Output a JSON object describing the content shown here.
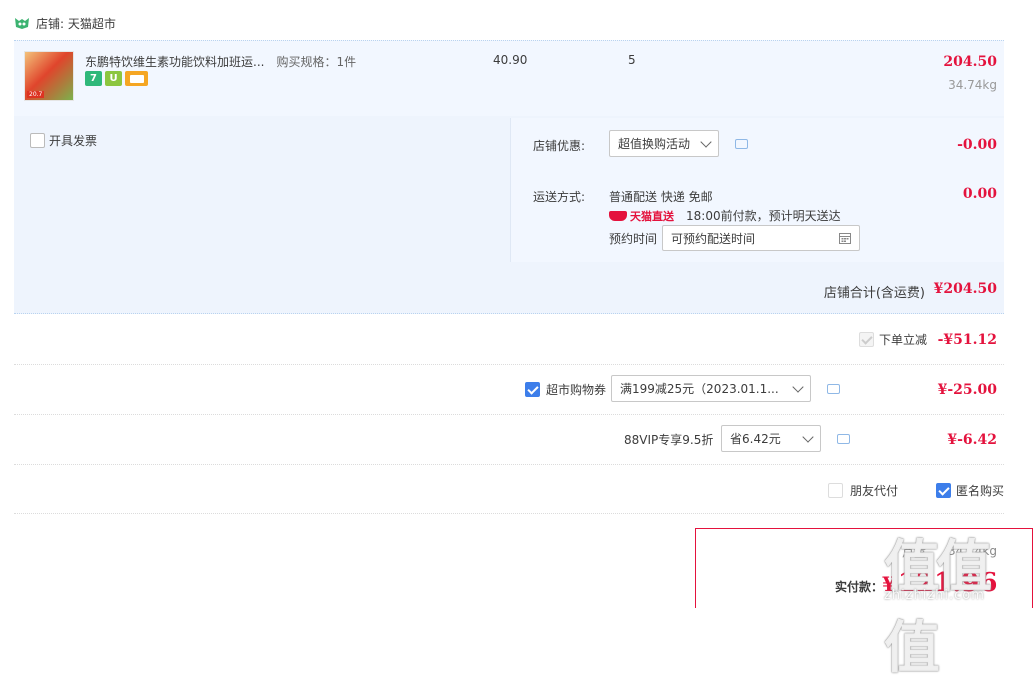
{
  "shop": {
    "label": "店铺: 天猫超市"
  },
  "item": {
    "title": "东鹏特饮维生素功能饮料加班运...",
    "spec": "购买规格：1件",
    "thumb_label": "20.7",
    "badges": [
      "7",
      "U"
    ],
    "price": "40.90",
    "qty": "5",
    "subtotal": "204.50",
    "weight": "34.74kg"
  },
  "invoice": {
    "label": "开具发票"
  },
  "discount": {
    "label": "店铺优惠:",
    "select": "超值换购活动",
    "amount": "-0.00"
  },
  "shipping": {
    "label": "运送方式:",
    "method": "普通配送 快递 免邮",
    "amount": "0.00",
    "brand": "天猫直送",
    "note": "18:00前付款，预计明天送达",
    "appointment_label": "预约时间",
    "appointment_value": "可预约配送时间"
  },
  "shop_total": {
    "label": "店铺合计(含运费)",
    "amount": "¥204.50"
  },
  "instant_discount": {
    "label": "下单立减",
    "amount": "-¥51.12"
  },
  "coupon": {
    "label": "超市购物券",
    "select": "满199减25元（2023.01.1...",
    "amount": "¥-25.00"
  },
  "vip": {
    "label": "88VIP专享9.5折",
    "select": "省6.42元",
    "amount": "¥-6.42"
  },
  "options": {
    "friend_pay": "朋友代付",
    "anonymous": "匿名购买"
  },
  "payment": {
    "weight_label": "总重",
    "weight": "34.74kg",
    "label": "实付款：",
    "currency": "¥",
    "amount": "121.96"
  },
  "watermark": {
    "text": "值值值",
    "url": "zhizhizhi.com"
  },
  "colors": {
    "price_red": "#e4123d",
    "accent_blue": "#3d7eea",
    "row_bg": "#f2f7ff"
  }
}
